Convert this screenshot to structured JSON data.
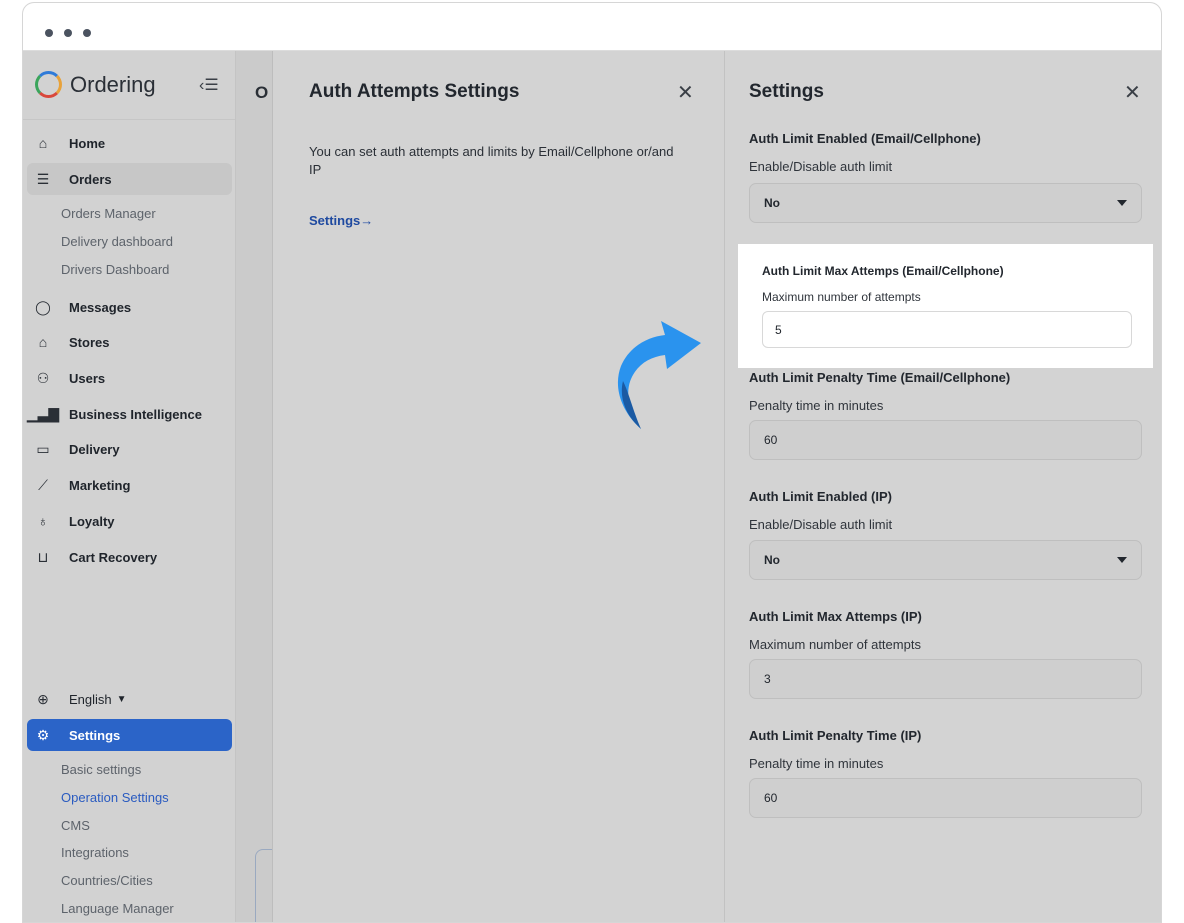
{
  "app": {
    "name": "Ordering"
  },
  "sidebar": {
    "items": [
      {
        "label": "Home",
        "icon": "home-icon"
      },
      {
        "label": "Orders",
        "icon": "list-icon"
      },
      {
        "label": "Messages",
        "icon": "chat-icon"
      },
      {
        "label": "Stores",
        "icon": "store-icon"
      },
      {
        "label": "Users",
        "icon": "users-icon"
      },
      {
        "label": "Business Intelligence",
        "icon": "bar-chart-icon"
      },
      {
        "label": "Delivery",
        "icon": "truck-icon"
      },
      {
        "label": "Marketing",
        "icon": "trend-icon"
      },
      {
        "label": "Loyalty",
        "icon": "award-icon"
      },
      {
        "label": "Cart Recovery",
        "icon": "cart-icon"
      }
    ],
    "orders_sub": [
      "Orders Manager",
      "Delivery dashboard",
      "Drivers Dashboard"
    ],
    "language": "English",
    "settings": {
      "label": "Settings",
      "sub": [
        "Basic settings",
        "Operation Settings",
        "CMS",
        "Integrations",
        "Countries/Cities",
        "Language Manager"
      ]
    }
  },
  "middle": {
    "partial_title": "O"
  },
  "panel1": {
    "title": "Auth Attempts Settings",
    "description": "You can set auth attempts and limits by Email/Cellphone or/and IP",
    "link": "Settings→"
  },
  "panel2": {
    "title": "Settings",
    "fields": [
      {
        "label": "Auth Limit Enabled (Email/Cellphone)",
        "description": "Enable/Disable auth limit",
        "value": "No",
        "type": "select"
      },
      {
        "label": "Auth Limit Max Attemps (Email/Cellphone)",
        "description": "Maximum number of attempts",
        "value": "5",
        "type": "input"
      },
      {
        "label": "Auth Limit Penalty Time (Email/Cellphone)",
        "description": "Penalty time in minutes",
        "value": "60",
        "type": "input"
      },
      {
        "label": "Auth Limit Enabled (IP)",
        "description": "Enable/Disable auth limit",
        "value": "No",
        "type": "select"
      },
      {
        "label": "Auth Limit Max Attemps (IP)",
        "description": "Maximum number of attempts",
        "value": "3",
        "type": "input"
      },
      {
        "label": "Auth Limit Penalty Time (IP)",
        "description": "Penalty time in minutes",
        "value": "60",
        "type": "input"
      }
    ]
  },
  "colors": {
    "accent": "#2b64c8",
    "link": "#1f4aa0",
    "arrow": "#2a93ee",
    "arrow_dark": "#1b5aa3"
  }
}
